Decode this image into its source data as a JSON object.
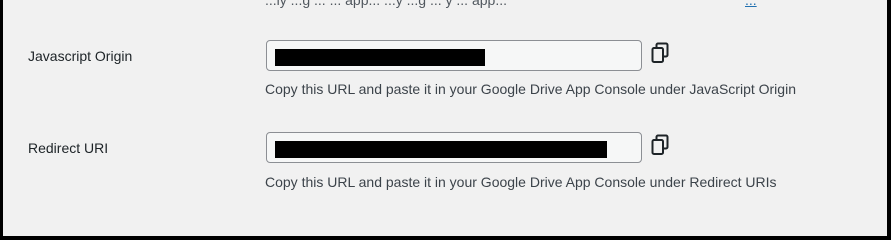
{
  "top_partial": {
    "text": "...ly ...g ... ... app... ...y ...g ... y ... app...",
    "link": "..."
  },
  "javascript_origin": {
    "label": "Javascript Origin",
    "value": "",
    "copy_icon": "copy-icon",
    "help": "Copy this URL and paste it in your Google Drive App Console under JavaScript Origin"
  },
  "redirect_uri": {
    "label": "Redirect URI",
    "value": "",
    "copy_icon": "copy-icon",
    "help": "Copy this URL and paste it in your Google Drive App Console under Redirect URIs"
  },
  "colors": {
    "background": "#f1f1f1",
    "field_bg": "#f6f7f7",
    "field_border": "#8c8f94",
    "text": "#3c434a",
    "link": "#2271b1"
  }
}
